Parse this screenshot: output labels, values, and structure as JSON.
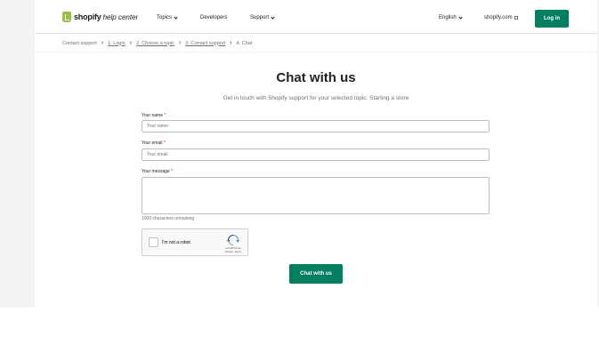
{
  "header": {
    "logo_word": "shopify",
    "logo_sub": "help center",
    "nav": {
      "topics": "Topics",
      "developers": "Developers",
      "support": "Support",
      "language": "English",
      "shopify_link": "shopify.com"
    },
    "login_label": "Log in"
  },
  "breadcrumb": {
    "items": [
      "Contact support",
      "1. Login",
      "2. Choose a topic",
      "3. Contact support",
      "4. Chat"
    ]
  },
  "main": {
    "title": "Chat with us",
    "subtitle": "Get in touch with Shopify support for your selected topic: Starting a store",
    "name_label": "Your name",
    "name_placeholder": "Your name",
    "email_label": "Your email",
    "email_placeholder": "Your email",
    "message_label": "Your message",
    "required_marker": "*",
    "chars_remaining": "1000 characters remaining",
    "captcha": {
      "label": "I'm not a robot",
      "brand": "reCAPTCHA",
      "links": "Privacy - Terms"
    },
    "submit_label": "Chat with us"
  },
  "colors": {
    "accent": "#008060",
    "logo_green": "#95bf47",
    "required": "#d72c0d"
  }
}
